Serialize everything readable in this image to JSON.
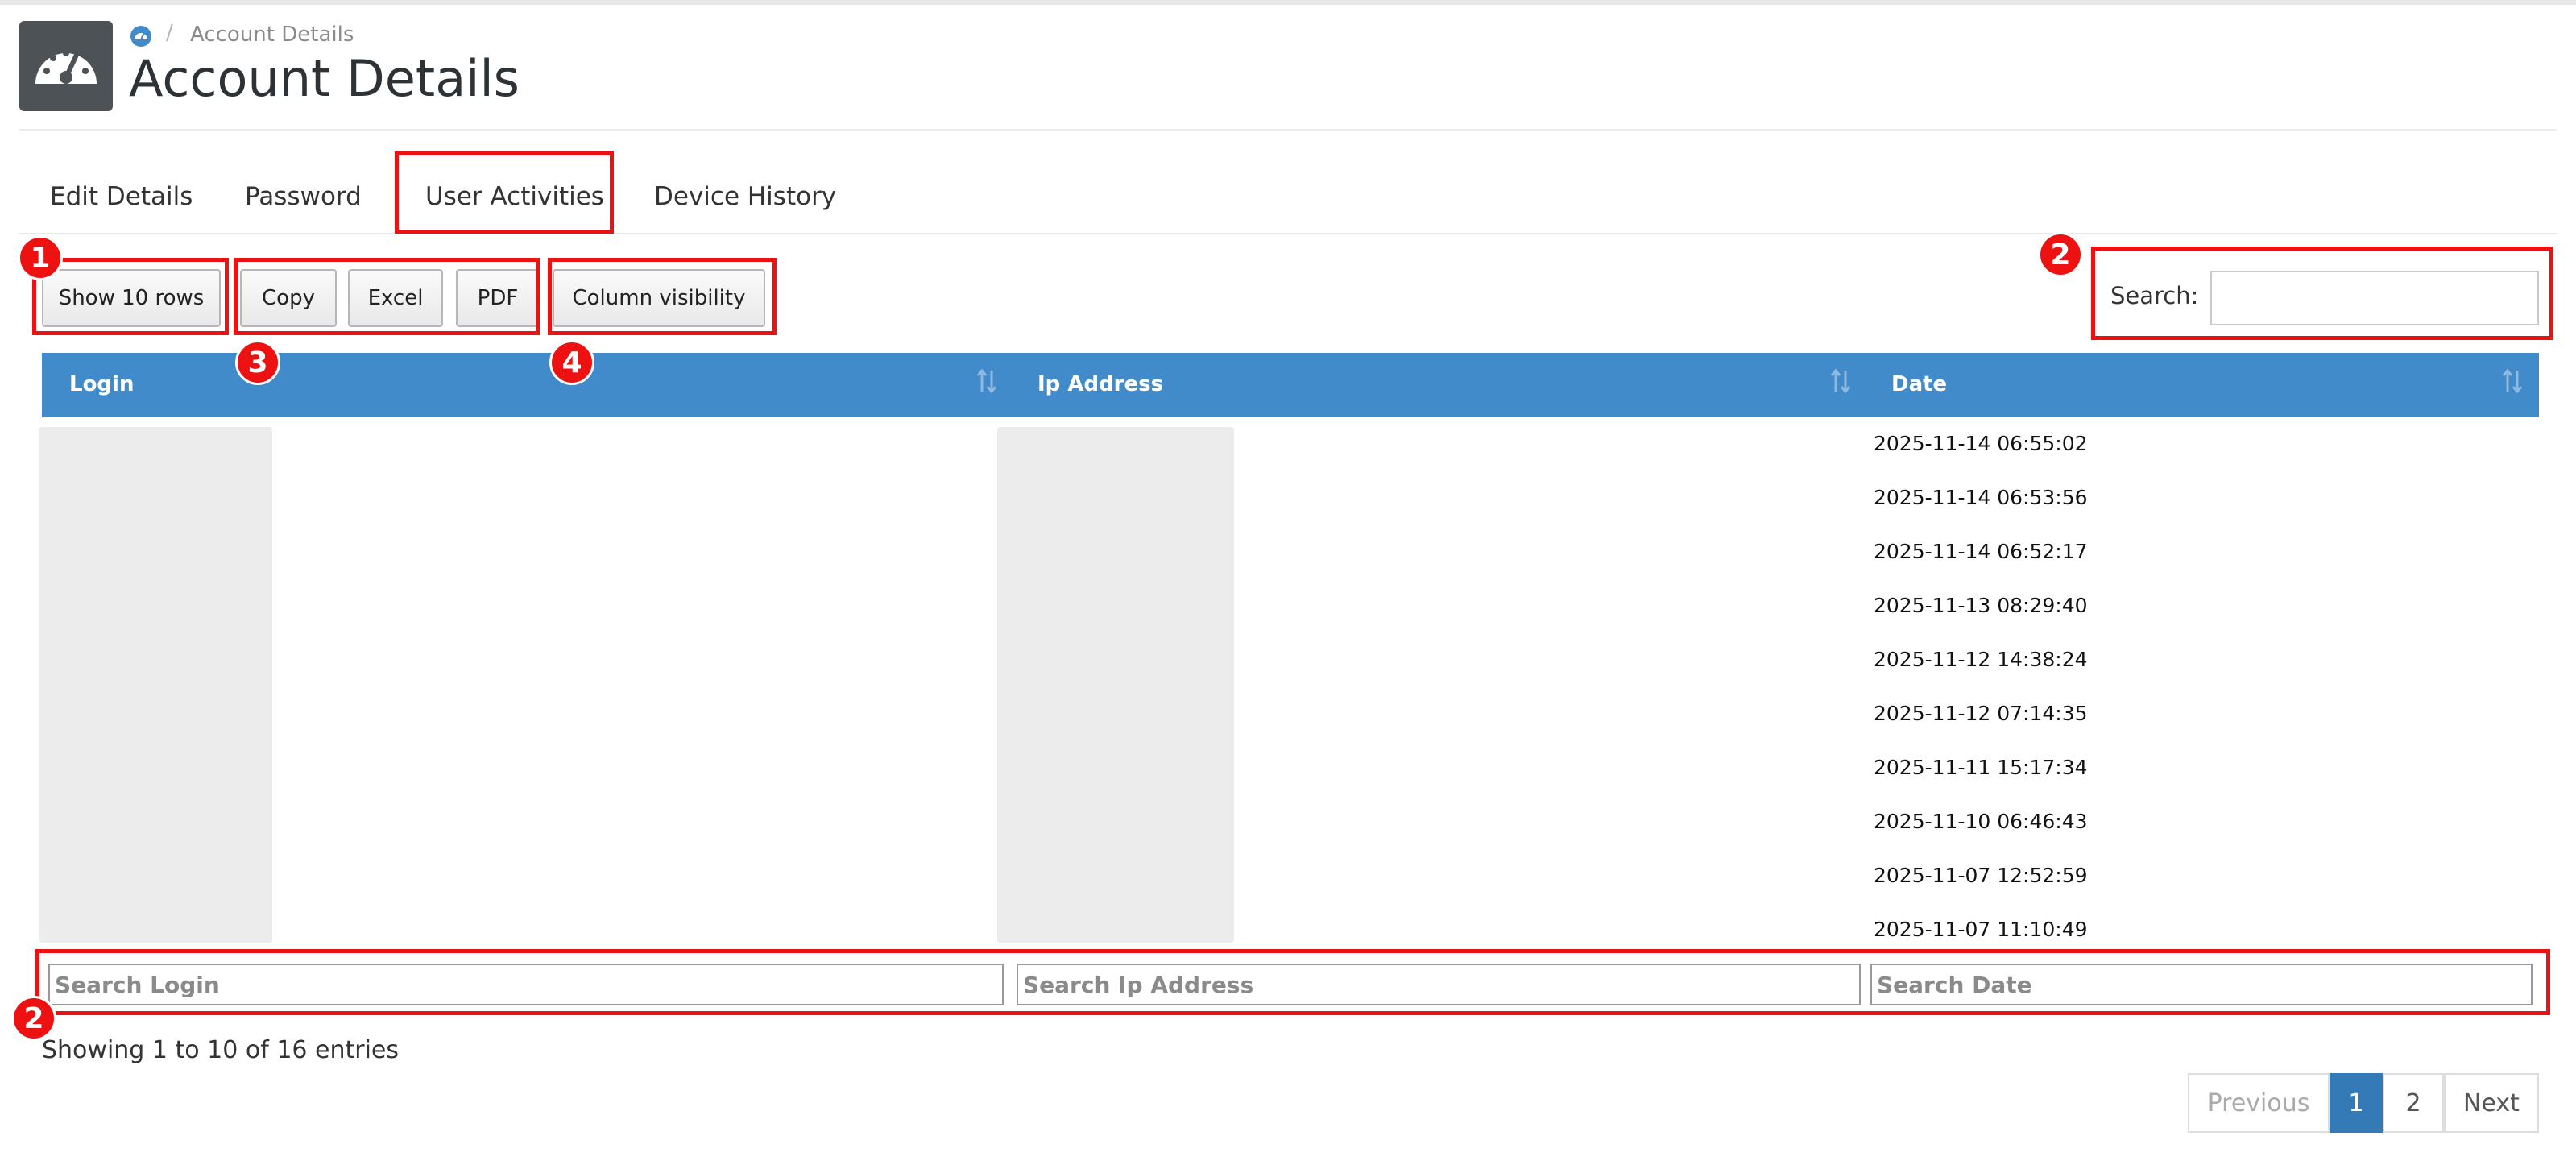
{
  "header": {
    "breadcrumb": "Account Details",
    "breadcrumb_sep": "/",
    "title": "Account Details",
    "icon": "dashboard-gauge-icon"
  },
  "tabs": [
    {
      "label": "Edit Details"
    },
    {
      "label": "Password"
    },
    {
      "label": "User Activities",
      "active": true
    },
    {
      "label": "Device History"
    }
  ],
  "toolbar": {
    "show_rows": "Show 10 rows",
    "copy": "Copy",
    "excel": "Excel",
    "pdf": "PDF",
    "column_visibility": "Column visibility"
  },
  "search": {
    "label": "Search:",
    "value": ""
  },
  "table": {
    "columns": [
      "Login",
      "Ip Address",
      "Date"
    ],
    "rows": [
      {
        "login": "",
        "ip": "",
        "date": "2025-11-14 06:55:02"
      },
      {
        "login": "",
        "ip": "",
        "date": "2025-11-14 06:53:56"
      },
      {
        "login": "",
        "ip": "",
        "date": "2025-11-14 06:52:17"
      },
      {
        "login": "",
        "ip": "",
        "date": "2025-11-13 08:29:40"
      },
      {
        "login": "",
        "ip": "",
        "date": "2025-11-12 14:38:24"
      },
      {
        "login": "",
        "ip": "",
        "date": "2025-11-12 07:14:35"
      },
      {
        "login": "",
        "ip": "",
        "date": "2025-11-11 15:17:34"
      },
      {
        "login": "",
        "ip": "",
        "date": "2025-11-10 06:46:43"
      },
      {
        "login": "",
        "ip": "",
        "date": "2025-11-07 12:52:59"
      },
      {
        "login": "",
        "ip": "",
        "date": "2025-11-07 11:10:49"
      }
    ],
    "footer_placeholders": [
      "Search Login",
      "Search Ip Address",
      "Search Date"
    ]
  },
  "info": "Showing 1 to 10 of 16 entries",
  "pagination": {
    "previous": "Previous",
    "pages": [
      "1",
      "2"
    ],
    "current": "1",
    "next": "Next"
  },
  "annotations": [
    "1",
    "2",
    "3",
    "4",
    "2"
  ],
  "colors": {
    "header": "#428bca",
    "annotation": "#ee1111",
    "page_active": "#337ab7"
  }
}
